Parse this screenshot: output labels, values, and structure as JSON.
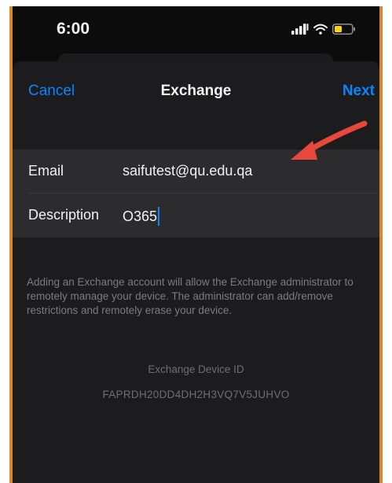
{
  "status_bar": {
    "time": "6:00",
    "icons": [
      "cellular-signal-icon",
      "wifi-icon",
      "battery-icon"
    ]
  },
  "nav": {
    "cancel_label": "Cancel",
    "title": "Exchange",
    "next_label": "Next"
  },
  "form": {
    "email_label": "Email",
    "email_value": "saifutest@qu.edu.qa",
    "description_label": "Description",
    "description_value": "O365"
  },
  "footer": {
    "note": "Adding an Exchange account will allow the Exchange administrator to remotely manage your device. The administrator can add/remove restrictions and remotely erase your device.",
    "device_id_label": "Exchange Device ID",
    "device_id_value": "FAPRDH20DD4DH2H3VQ7V5JUHVO"
  },
  "annotation": {
    "arrow_color": "#e8473b"
  },
  "colors": {
    "accent": "#0a84ff",
    "frame": "#d9882c",
    "background": "#0c0c0c",
    "sheet": "#1c1c1e",
    "group": "#2c2c2e"
  }
}
